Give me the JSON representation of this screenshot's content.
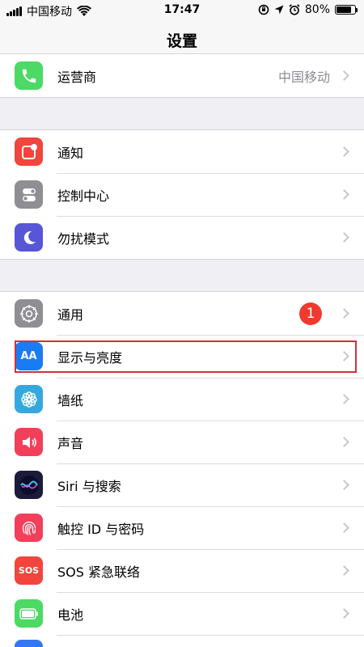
{
  "status_bar": {
    "carrier": "中国移动",
    "time": "17:47",
    "battery": "80%",
    "battery_level": 0.8
  },
  "nav": {
    "title": "设置"
  },
  "groups": [
    {
      "rows": [
        {
          "label": "运营商",
          "detail": "中国移动",
          "icon": "phone-icon",
          "color": "#4cd964"
        }
      ]
    },
    {
      "rows": [
        {
          "label": "通知",
          "icon": "notification-icon",
          "color": "#f2453d"
        },
        {
          "label": "控制中心",
          "icon": "toggle-icon",
          "color": "#8e8e93"
        },
        {
          "label": "勿扰模式",
          "icon": "moon-icon",
          "color": "#5856d6"
        }
      ]
    },
    {
      "rows": [
        {
          "label": "通用",
          "badge": "1",
          "icon": "gear-icon",
          "color": "#8e8e93"
        },
        {
          "label": "显示与亮度",
          "icon": "text-size-icon",
          "color": "#1a7cf5",
          "icon_text": "AA"
        },
        {
          "label": "墙纸",
          "icon": "flower-icon",
          "color": "#36a8e0"
        },
        {
          "label": "声音",
          "icon": "speaker-icon",
          "color": "#f2405a"
        },
        {
          "label": "Siri 与搜索",
          "icon": "siri-icon",
          "color": "#1c1c3a"
        },
        {
          "label": "触控 ID 与密码",
          "icon": "fingerprint-icon",
          "color": "#f2405a"
        },
        {
          "label": "SOS 紧急联络",
          "icon": "sos-icon",
          "color": "#f2453d",
          "icon_text": "SOS"
        },
        {
          "label": "电池",
          "icon": "battery-icon",
          "color": "#4cd964"
        }
      ]
    }
  ],
  "highlight_color": "#d0303a"
}
